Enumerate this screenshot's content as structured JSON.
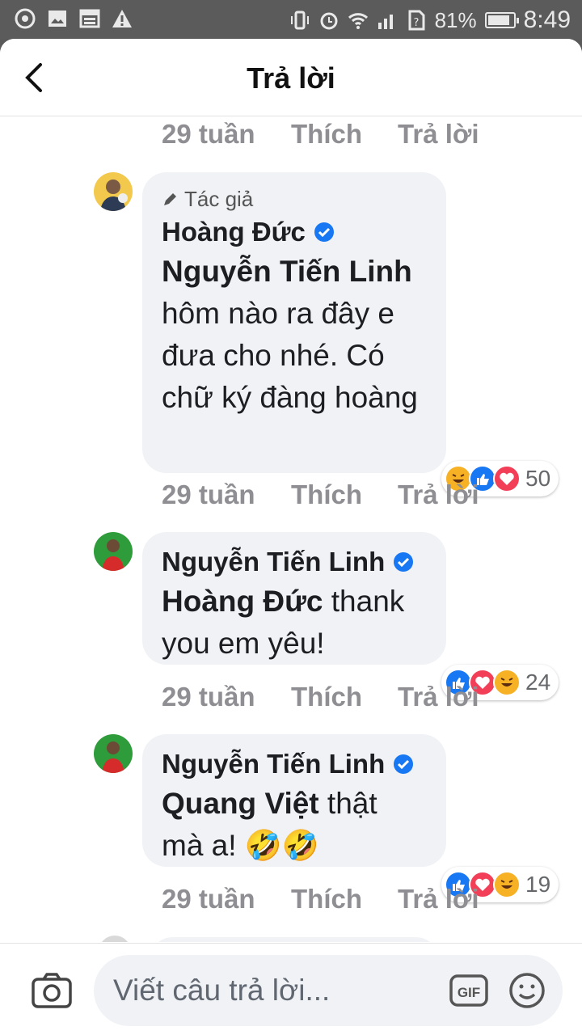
{
  "status_bar": {
    "battery": "81%",
    "time": "8:49",
    "icons": [
      "sync-icon",
      "image-icon",
      "calendar-icon",
      "warning-icon",
      "vibrate-icon",
      "alarm-icon",
      "wifi-icon",
      "signal-icon",
      "sim-icon",
      "battery-icon"
    ]
  },
  "header": {
    "title": "Trả lời",
    "back_icon": "chevron-left-icon"
  },
  "top_actions": {
    "time": "29 tuần",
    "like": "Thích",
    "reply": "Trả lời"
  },
  "comments": [
    {
      "author_tag": "Tác giả",
      "name": "Hoàng Đức",
      "verified": true,
      "mention": "Nguyễn Tiến Linh",
      "text": " hôm nào ra đây e đưa cho nhé. Có chữ ký đàng hoàng",
      "reactions": [
        "haha",
        "like",
        "love"
      ],
      "reaction_count": "50",
      "time": "29 tuần",
      "like": "Thích",
      "reply": "Trả lời"
    },
    {
      "name": "Nguyễn Tiến Linh",
      "verified": true,
      "mention": "Hoàng Đức",
      "text": " thank you em yêu!",
      "reactions": [
        "like",
        "love",
        "haha"
      ],
      "reaction_count": "24",
      "time": "29 tuần",
      "like": "Thích",
      "reply": "Trả lời"
    },
    {
      "name": "Nguyễn Tiến Linh",
      "verified": true,
      "mention": "Quang Việt",
      "text": " thật mà a! 🤣🤣",
      "reactions": [
        "like",
        "love",
        "haha"
      ],
      "reaction_count": "19",
      "time": "29 tuần",
      "like": "Thích",
      "reply": "Trả lời"
    }
  ],
  "composer": {
    "placeholder": "Viết câu trả lời...",
    "gif_label": "GIF"
  },
  "colors": {
    "like_blue": "#1877f2",
    "love_red": "#f33e58",
    "haha_yellow": "#f7b125",
    "bubble_bg": "#f0f2f5"
  }
}
